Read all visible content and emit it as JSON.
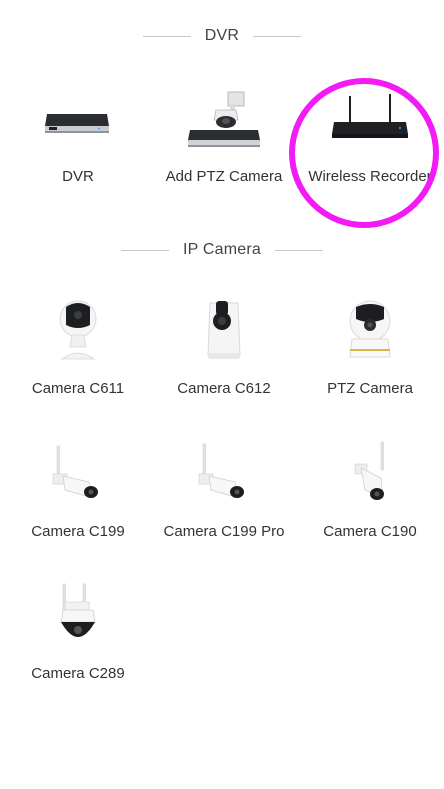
{
  "sections": {
    "dvr": {
      "title": "DVR",
      "items": [
        {
          "label": "DVR"
        },
        {
          "label": "Add PTZ Camera"
        },
        {
          "label": "Wireless Recorder"
        }
      ]
    },
    "ip_camera": {
      "title": "IP Camera",
      "items": [
        {
          "label": "Camera C611"
        },
        {
          "label": "Camera C612"
        },
        {
          "label": "PTZ Camera"
        },
        {
          "label": "Camera C199"
        },
        {
          "label": "Camera C199 Pro"
        },
        {
          "label": "Camera C190"
        },
        {
          "label": "Camera C289"
        }
      ]
    }
  },
  "highlight": {
    "color": "#f21bf5",
    "target": "Wireless Recorder"
  }
}
